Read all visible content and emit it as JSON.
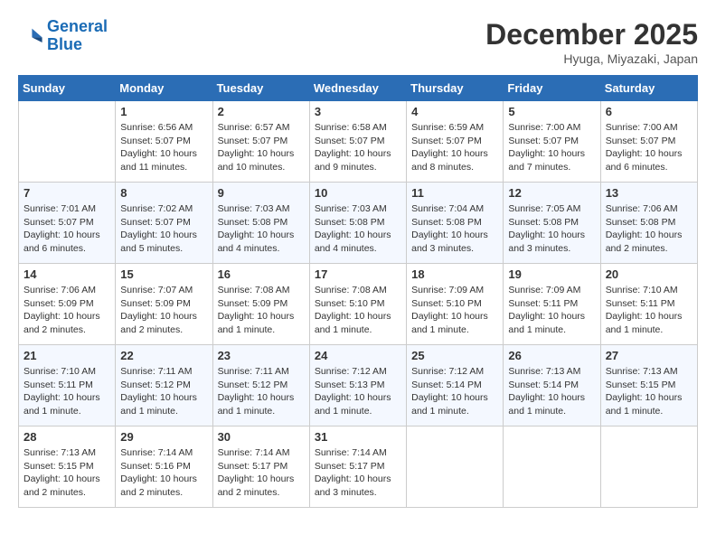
{
  "header": {
    "logo_line1": "General",
    "logo_line2": "Blue",
    "month": "December 2025",
    "location": "Hyuga, Miyazaki, Japan"
  },
  "weekdays": [
    "Sunday",
    "Monday",
    "Tuesday",
    "Wednesday",
    "Thursday",
    "Friday",
    "Saturday"
  ],
  "weeks": [
    [
      {
        "day": "",
        "info": ""
      },
      {
        "day": "1",
        "info": "Sunrise: 6:56 AM\nSunset: 5:07 PM\nDaylight: 10 hours\nand 11 minutes."
      },
      {
        "day": "2",
        "info": "Sunrise: 6:57 AM\nSunset: 5:07 PM\nDaylight: 10 hours\nand 10 minutes."
      },
      {
        "day": "3",
        "info": "Sunrise: 6:58 AM\nSunset: 5:07 PM\nDaylight: 10 hours\nand 9 minutes."
      },
      {
        "day": "4",
        "info": "Sunrise: 6:59 AM\nSunset: 5:07 PM\nDaylight: 10 hours\nand 8 minutes."
      },
      {
        "day": "5",
        "info": "Sunrise: 7:00 AM\nSunset: 5:07 PM\nDaylight: 10 hours\nand 7 minutes."
      },
      {
        "day": "6",
        "info": "Sunrise: 7:00 AM\nSunset: 5:07 PM\nDaylight: 10 hours\nand 6 minutes."
      }
    ],
    [
      {
        "day": "7",
        "info": "Sunrise: 7:01 AM\nSunset: 5:07 PM\nDaylight: 10 hours\nand 6 minutes."
      },
      {
        "day": "8",
        "info": "Sunrise: 7:02 AM\nSunset: 5:07 PM\nDaylight: 10 hours\nand 5 minutes."
      },
      {
        "day": "9",
        "info": "Sunrise: 7:03 AM\nSunset: 5:08 PM\nDaylight: 10 hours\nand 4 minutes."
      },
      {
        "day": "10",
        "info": "Sunrise: 7:03 AM\nSunset: 5:08 PM\nDaylight: 10 hours\nand 4 minutes."
      },
      {
        "day": "11",
        "info": "Sunrise: 7:04 AM\nSunset: 5:08 PM\nDaylight: 10 hours\nand 3 minutes."
      },
      {
        "day": "12",
        "info": "Sunrise: 7:05 AM\nSunset: 5:08 PM\nDaylight: 10 hours\nand 3 minutes."
      },
      {
        "day": "13",
        "info": "Sunrise: 7:06 AM\nSunset: 5:08 PM\nDaylight: 10 hours\nand 2 minutes."
      }
    ],
    [
      {
        "day": "14",
        "info": "Sunrise: 7:06 AM\nSunset: 5:09 PM\nDaylight: 10 hours\nand 2 minutes."
      },
      {
        "day": "15",
        "info": "Sunrise: 7:07 AM\nSunset: 5:09 PM\nDaylight: 10 hours\nand 2 minutes."
      },
      {
        "day": "16",
        "info": "Sunrise: 7:08 AM\nSunset: 5:09 PM\nDaylight: 10 hours\nand 1 minute."
      },
      {
        "day": "17",
        "info": "Sunrise: 7:08 AM\nSunset: 5:10 PM\nDaylight: 10 hours\nand 1 minute."
      },
      {
        "day": "18",
        "info": "Sunrise: 7:09 AM\nSunset: 5:10 PM\nDaylight: 10 hours\nand 1 minute."
      },
      {
        "day": "19",
        "info": "Sunrise: 7:09 AM\nSunset: 5:11 PM\nDaylight: 10 hours\nand 1 minute."
      },
      {
        "day": "20",
        "info": "Sunrise: 7:10 AM\nSunset: 5:11 PM\nDaylight: 10 hours\nand 1 minute."
      }
    ],
    [
      {
        "day": "21",
        "info": "Sunrise: 7:10 AM\nSunset: 5:11 PM\nDaylight: 10 hours\nand 1 minute."
      },
      {
        "day": "22",
        "info": "Sunrise: 7:11 AM\nSunset: 5:12 PM\nDaylight: 10 hours\nand 1 minute."
      },
      {
        "day": "23",
        "info": "Sunrise: 7:11 AM\nSunset: 5:12 PM\nDaylight: 10 hours\nand 1 minute."
      },
      {
        "day": "24",
        "info": "Sunrise: 7:12 AM\nSunset: 5:13 PM\nDaylight: 10 hours\nand 1 minute."
      },
      {
        "day": "25",
        "info": "Sunrise: 7:12 AM\nSunset: 5:14 PM\nDaylight: 10 hours\nand 1 minute."
      },
      {
        "day": "26",
        "info": "Sunrise: 7:13 AM\nSunset: 5:14 PM\nDaylight: 10 hours\nand 1 minute."
      },
      {
        "day": "27",
        "info": "Sunrise: 7:13 AM\nSunset: 5:15 PM\nDaylight: 10 hours\nand 1 minute."
      }
    ],
    [
      {
        "day": "28",
        "info": "Sunrise: 7:13 AM\nSunset: 5:15 PM\nDaylight: 10 hours\nand 2 minutes."
      },
      {
        "day": "29",
        "info": "Sunrise: 7:14 AM\nSunset: 5:16 PM\nDaylight: 10 hours\nand 2 minutes."
      },
      {
        "day": "30",
        "info": "Sunrise: 7:14 AM\nSunset: 5:17 PM\nDaylight: 10 hours\nand 2 minutes."
      },
      {
        "day": "31",
        "info": "Sunrise: 7:14 AM\nSunset: 5:17 PM\nDaylight: 10 hours\nand 3 minutes."
      },
      {
        "day": "",
        "info": ""
      },
      {
        "day": "",
        "info": ""
      },
      {
        "day": "",
        "info": ""
      }
    ]
  ]
}
